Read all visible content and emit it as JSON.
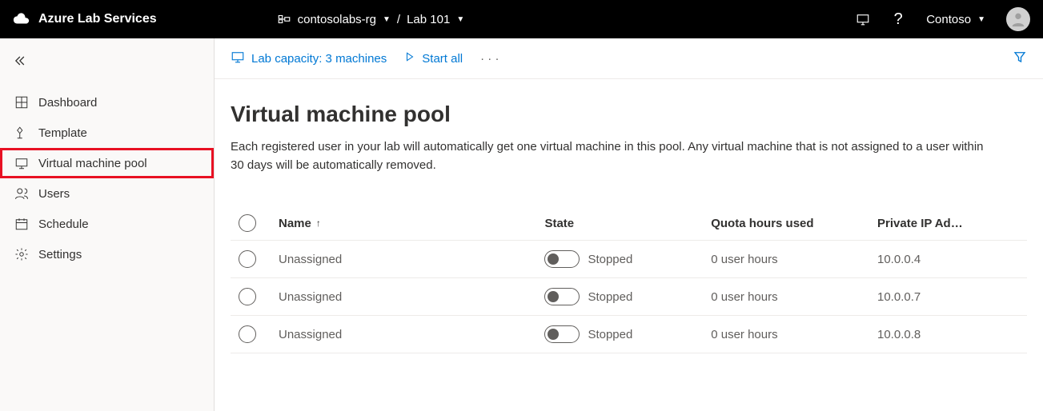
{
  "header": {
    "product": "Azure Lab Services",
    "resourceGroup": "contosolabs-rg",
    "lab": "Lab 101",
    "user": "Contoso"
  },
  "sidebar": {
    "items": [
      {
        "label": "Dashboard"
      },
      {
        "label": "Template"
      },
      {
        "label": "Virtual machine pool"
      },
      {
        "label": "Users"
      },
      {
        "label": "Schedule"
      },
      {
        "label": "Settings"
      }
    ]
  },
  "toolbar": {
    "capacity": "Lab capacity: 3 machines",
    "startAll": "Start all"
  },
  "page": {
    "title": "Virtual machine pool",
    "description": "Each registered user in your lab will automatically get one virtual machine in this pool. Any virtual machine that is not assigned to a user within 30 days will be automatically removed."
  },
  "table": {
    "headers": {
      "name": "Name",
      "state": "State",
      "quota": "Quota hours used",
      "ip": "Private IP Ad…"
    },
    "rows": [
      {
        "name": "Unassigned",
        "state": "Stopped",
        "quota": "0 user hours",
        "ip": "10.0.0.4"
      },
      {
        "name": "Unassigned",
        "state": "Stopped",
        "quota": "0 user hours",
        "ip": "10.0.0.7"
      },
      {
        "name": "Unassigned",
        "state": "Stopped",
        "quota": "0 user hours",
        "ip": "10.0.0.8"
      }
    ]
  }
}
